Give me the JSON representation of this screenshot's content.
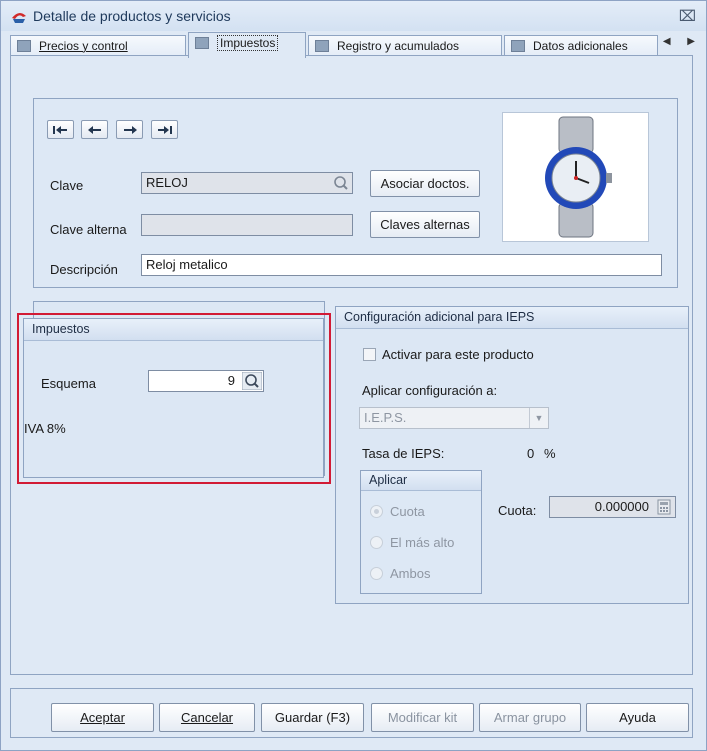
{
  "window": {
    "title": "Detalle de productos y servicios",
    "close_glyph": "⌧"
  },
  "tabs": [
    {
      "label": "Precios y control",
      "icon": "price-list-icon"
    },
    {
      "label": "Impuestos",
      "icon": "tax-icon",
      "active": true
    },
    {
      "label": "Registro y acumulados",
      "icon": "register-icon"
    },
    {
      "label": "Datos adicionales",
      "icon": "extra-data-icon"
    }
  ],
  "tab_scroll": {
    "left": "◀",
    "right": "▶"
  },
  "product": {
    "clave_label": "Clave",
    "clave_value": "RELOJ",
    "clave_alterna_label": "Clave alterna",
    "clave_alterna_value": "",
    "descripcion_label": "Descripción",
    "descripcion_value": "Reloj metalico",
    "asociar_button": "Asociar doctos.",
    "claves_button": "Claves alternas",
    "image": "wristwatch-photo"
  },
  "impuestos": {
    "title": "Impuestos",
    "esquema_label": "Esquema",
    "esquema_value": "9",
    "iva_text": "IVA 8%"
  },
  "ieps": {
    "title": "Configuración adicional para IEPS",
    "activar_label": "Activar para este producto",
    "aplicar_config_label": "Aplicar configuración a:",
    "aplicar_config_value": "I.E.P.S.",
    "tasa_label": "Tasa de IEPS:",
    "tasa_value": "0",
    "tasa_unit": "%",
    "aplicar_group": "Aplicar",
    "options": [
      "Cuota",
      "El más alto",
      "Ambos"
    ],
    "selected_option": "Cuota",
    "cuota_label": "Cuota:",
    "cuota_value": "0.000000"
  },
  "buttons": {
    "aceptar": "Aceptar",
    "cancelar": "Cancelar",
    "guardar": "Guardar (F3)",
    "modificar": "Modificar kit",
    "armar": "Armar grupo",
    "ayuda": "Ayuda"
  },
  "colors": {
    "highlight": "#d21b35",
    "accent": "#1e395b"
  }
}
